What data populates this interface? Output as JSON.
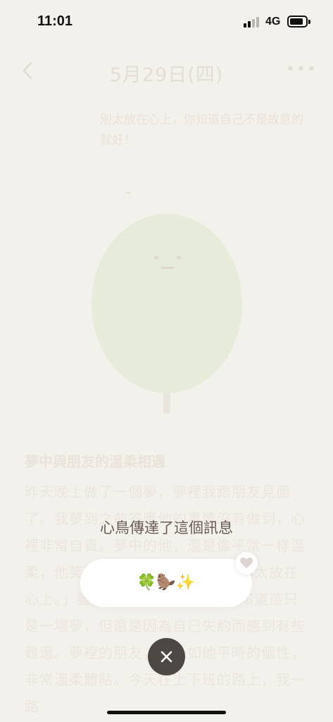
{
  "status_bar": {
    "time": "11:01",
    "network": "4G",
    "signal_bars_active": 2,
    "signal_bars_total": 4,
    "battery_level": 0.7
  },
  "page": {
    "title": "5月29日(四)",
    "speech_bubble": "別太放在心上，你知道自己不是故意的就好！",
    "entry_title": "夢中與朋友的溫柔相遇",
    "entry_body": "昨天晚上做了一個夢，夢裡我跟朋友見面了。我夢到之前答應他的事情沒有做到，心裡非常自責。夢中的他，還是像平常一樣溫柔，他笑著對我說：「沒有關係，別太放在心上。」雖然是在夢裡，我也清楚知道這只是一場夢，但還是因為自己失約而感到有些難過。夢裡的朋友，也一如他平時的個性，非常溫柔體貼。今天在上下班的路上，我一路"
  },
  "modal": {
    "caption": "心鳥傳達了這個訊息",
    "message": "🍀🦫✨"
  },
  "icons": {
    "back": "chevron-left-icon",
    "more": "more-dots-icon",
    "heart": "heart-icon",
    "close": "close-icon"
  },
  "colors": {
    "background": "#f3f1ec",
    "creature": "#e6ecd9",
    "close_button": "#4d4844",
    "caption": "#6b5a55"
  }
}
